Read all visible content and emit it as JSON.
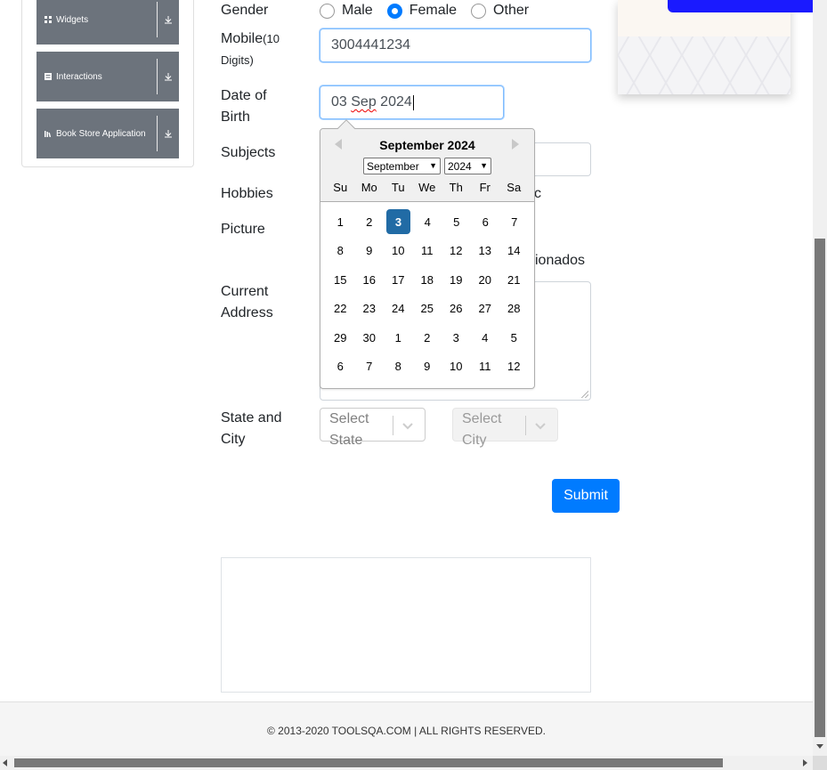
{
  "sidebar": {
    "groups": [
      {
        "label": "Widgets",
        "icon": "grid-icon"
      },
      {
        "label": "Interactions",
        "icon": "list-icon"
      },
      {
        "label": "Book Store Application",
        "icon": "books-icon"
      }
    ]
  },
  "form": {
    "gender_label": "Gender",
    "gender_options": [
      "Male",
      "Female",
      "Other"
    ],
    "gender_selected": "Female",
    "mobile_label": "Mobile",
    "mobile_sub": "(10 Digits)",
    "mobile_value": "3004441234",
    "dob_label": "Date of Birth",
    "dob_value_day": "03",
    "dob_value_month": "Sep",
    "dob_value_year": "2024",
    "subjects_label": "Subjects",
    "hobbies_label": "Hobbies",
    "hobbies_partial": "c",
    "picture_label": "Picture",
    "picture_partial": "ionados",
    "address_label": "Current Address",
    "state_city_label": "State and City",
    "state_placeholder": "Select State",
    "city_placeholder": "Select City",
    "submit_label": "Submit"
  },
  "datepicker": {
    "title": "September 2024",
    "month_select": "September",
    "year_select": "2024",
    "day_names": [
      "Su",
      "Mo",
      "Tu",
      "We",
      "Th",
      "Fr",
      "Sa"
    ],
    "weeks": [
      [
        "1",
        "2",
        "3",
        "4",
        "5",
        "6",
        "7"
      ],
      [
        "8",
        "9",
        "10",
        "11",
        "12",
        "13",
        "14"
      ],
      [
        "15",
        "16",
        "17",
        "18",
        "19",
        "20",
        "21"
      ],
      [
        "22",
        "23",
        "24",
        "25",
        "26",
        "27",
        "28"
      ],
      [
        "29",
        "30",
        "1",
        "2",
        "3",
        "4",
        "5"
      ],
      [
        "6",
        "7",
        "8",
        "9",
        "10",
        "11",
        "12"
      ]
    ],
    "selected_day": "3"
  },
  "footer": {
    "text": "© 2013-2020 TOOLSQA.COM | ALL RIGHTS RESERVED."
  },
  "colors": {
    "accent": "#007bff",
    "selected_day": "#216ba5",
    "sidebar_bg": "#6c737c"
  }
}
